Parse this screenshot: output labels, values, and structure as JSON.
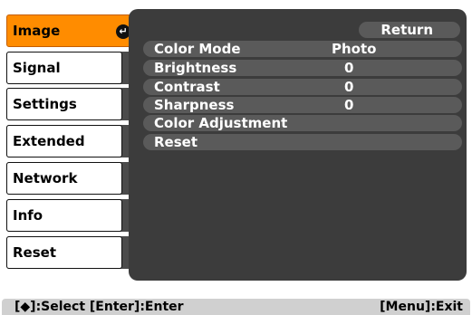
{
  "sidebar": {
    "items": [
      {
        "label": "Image",
        "active": true
      },
      {
        "label": "Signal"
      },
      {
        "label": "Settings"
      },
      {
        "label": "Extended"
      },
      {
        "label": "Network"
      },
      {
        "label": "Info"
      },
      {
        "label": "Reset"
      }
    ],
    "enter_icon": "enter-icon"
  },
  "panel": {
    "return_label": "Return",
    "rows": [
      {
        "label": "Color Mode",
        "value": "Photo"
      },
      {
        "label": "Brightness",
        "value": "0"
      },
      {
        "label": "Contrast",
        "value": "0"
      },
      {
        "label": "Sharpness",
        "value": "0"
      },
      {
        "label": "Color Adjustment",
        "value": ""
      },
      {
        "label": "Reset",
        "value": ""
      }
    ]
  },
  "statusbar": {
    "left": "[◆]:Select  [Enter]:Enter",
    "right": "[Menu]:Exit"
  },
  "colors": {
    "accent": "#ff8c00",
    "panel": "#3c3c3c",
    "row": "#5a5a5a",
    "statusbar": "#d0d0d0"
  }
}
